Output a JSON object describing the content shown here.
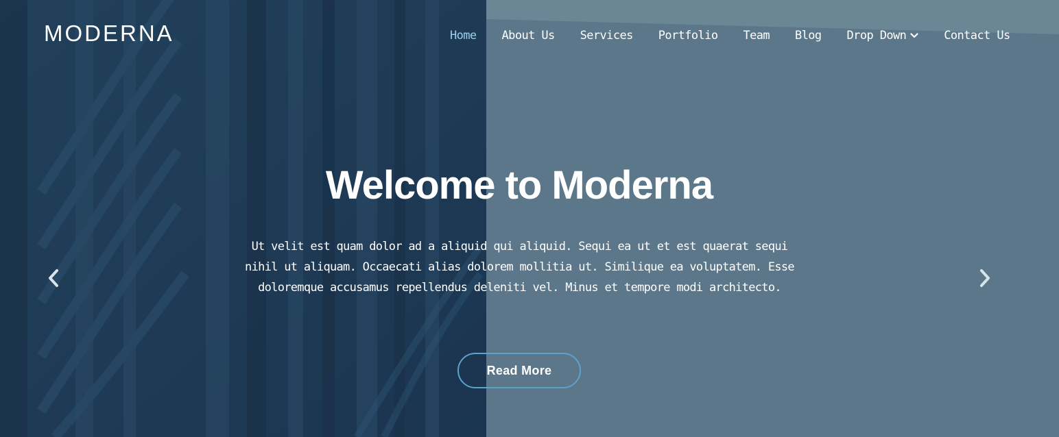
{
  "brand": {
    "logo_text": "MODERNA"
  },
  "nav": {
    "items": [
      {
        "label": "Home",
        "active": true
      },
      {
        "label": "About Us"
      },
      {
        "label": "Services"
      },
      {
        "label": "Portfolio"
      },
      {
        "label": "Team"
      },
      {
        "label": "Blog"
      },
      {
        "label": "Drop Down",
        "has_dropdown": true
      },
      {
        "label": "Contact Us"
      }
    ]
  },
  "hero": {
    "title": "Welcome to Moderna",
    "description": "Ut velit est quam dolor ad a aliquid qui aliquid. Sequi ea ut et est quaerat sequi nihil ut aliquam. Occaecati alias dolorem mollitia ut. Similique ea voluptatem. Esse doloremque accusamus repellendus deleniti vel. Minus et tempore modi architecto.",
    "button_label": "Read More"
  },
  "icons": {
    "prev": "chevron-left-icon",
    "next": "chevron-right-icon",
    "dropdown": "chevron-down-icon"
  },
  "colors": {
    "overlay_left": "#1e3a52",
    "overlay_right": "#5b7789",
    "active_nav": "#9fd0ee",
    "button_border": "#5aa3cc"
  }
}
